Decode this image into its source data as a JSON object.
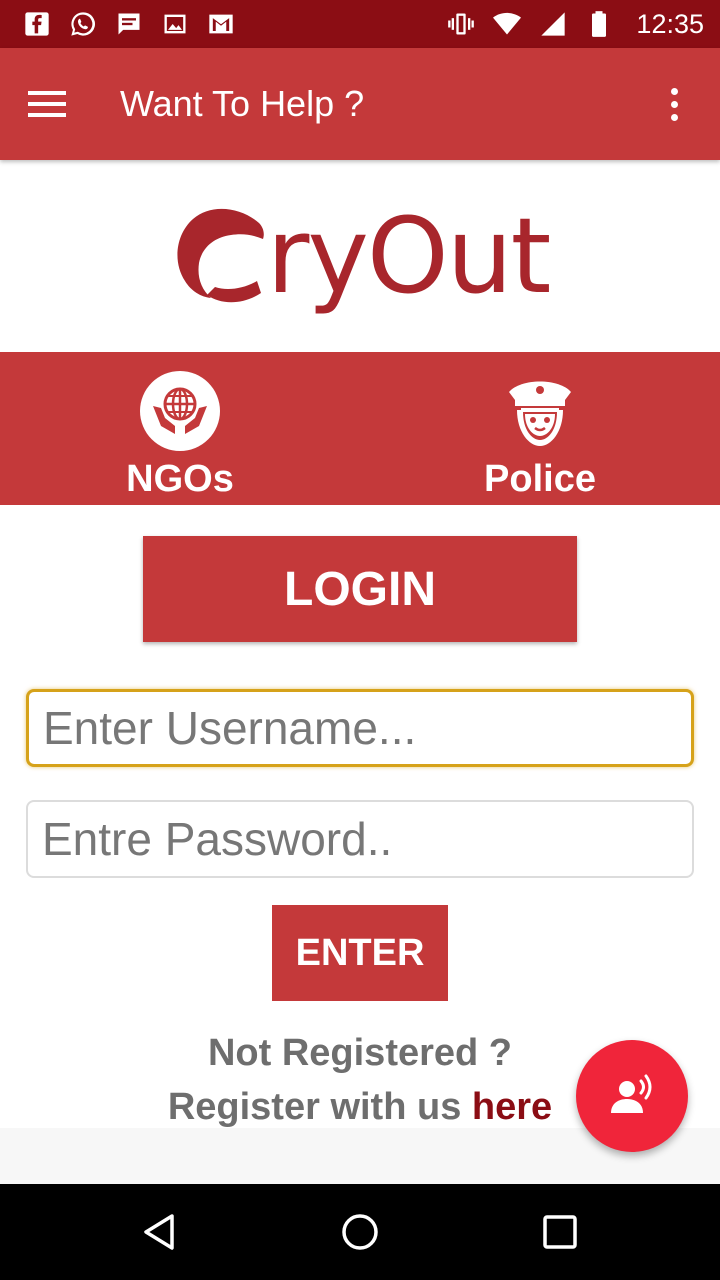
{
  "status_bar": {
    "time": "12:35",
    "left_icons": [
      "facebook-icon",
      "whatsapp-icon",
      "message-icon",
      "gallery-icon",
      "gmail-icon"
    ],
    "right_icons": [
      "vibrate-icon",
      "wifi-icon",
      "signal-icon",
      "battery-icon"
    ]
  },
  "app_bar": {
    "title": "Want To Help ?",
    "color": "#c4393a"
  },
  "logo": {
    "text": "ryOut",
    "color": "#a8262c"
  },
  "categories": [
    {
      "label": "NGOs",
      "icon": "globe-hands-icon"
    },
    {
      "label": "Police",
      "icon": "police-officer-icon"
    }
  ],
  "login": {
    "heading": "LOGIN",
    "username_placeholder": "Enter Username...",
    "password_placeholder": "Entre Password..",
    "enter_label": "ENTER"
  },
  "register": {
    "line1": "Not Registered ?",
    "line2_prefix": "Register with us ",
    "link_label": "here"
  },
  "fab": {
    "icon": "voice-speaker-icon",
    "color": "#f0253a"
  },
  "nav_bar": {
    "buttons": [
      "back-icon",
      "home-icon",
      "recents-icon"
    ]
  }
}
